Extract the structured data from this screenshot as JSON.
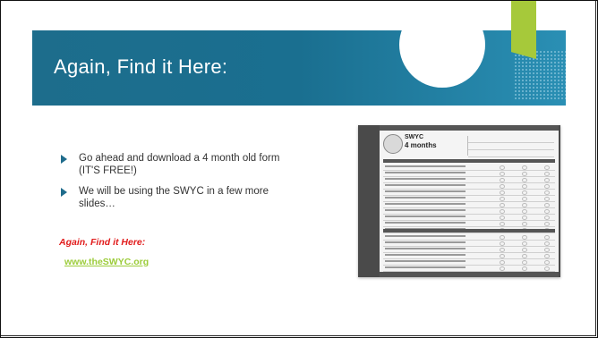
{
  "slide": {
    "title": "Again, Find it Here:",
    "bullets": [
      "Go ahead and download a 4 month old form (IT'S FREE!)",
      "We will be using the SWYC in a few more slides…"
    ],
    "find_label": "Again, Find it Here:",
    "link_text": "www.theSWYC.org"
  },
  "form_image": {
    "brand": "SWYC",
    "age_label": "4 months"
  },
  "colors": {
    "banner": "#1d6d8c",
    "accent_green": "#a6c93a",
    "find_red": "#e11c1c",
    "link_green": "#9ccc3a"
  }
}
